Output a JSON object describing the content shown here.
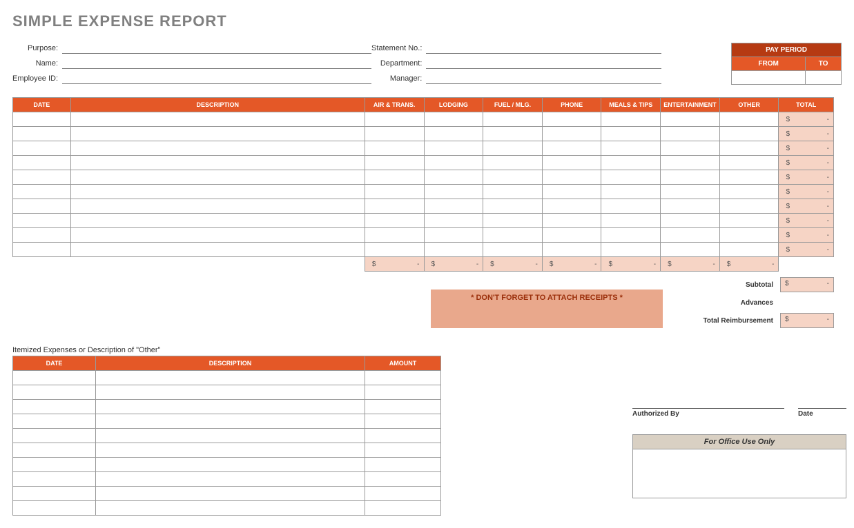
{
  "title": "SIMPLE EXPENSE REPORT",
  "info_left": [
    {
      "label": "Purpose:"
    },
    {
      "label": "Name:"
    },
    {
      "label": "Employee ID:"
    }
  ],
  "info_right": [
    {
      "label": "Statement No.:"
    },
    {
      "label": "Department:"
    },
    {
      "label": "Manager:"
    }
  ],
  "pay_period": {
    "title": "PAY PERIOD",
    "from": "FROM",
    "to": "TO"
  },
  "main_headers": [
    "DATE",
    "DESCRIPTION",
    "AIR & TRANS.",
    "LODGING",
    "FUEL / MLG.",
    "PHONE",
    "MEALS & TIPS",
    "ENTERTAINMENT",
    "OTHER",
    "TOTAL"
  ],
  "main_rows": 10,
  "row_total_display": {
    "cur": "$",
    "dash": "-"
  },
  "col_sum_display": {
    "cur": "$",
    "dash": "-"
  },
  "receipt_note": "* DON'T FORGET TO ATTACH RECEIPTS *",
  "summary": {
    "subtotal": {
      "label": "Subtotal",
      "cur": "$",
      "dash": "-"
    },
    "advances": {
      "label": "Advances"
    },
    "total": {
      "label": "Total Reimbursement",
      "cur": "$",
      "dash": "-"
    }
  },
  "itemized": {
    "title": "Itemized Expenses or Description of \"Other\"",
    "headers": [
      "DATE",
      "DESCRIPTION",
      "AMOUNT"
    ],
    "rows": 10
  },
  "auth": {
    "by": "Authorized By",
    "date": "Date"
  },
  "office": {
    "title": "For Office Use Only"
  }
}
